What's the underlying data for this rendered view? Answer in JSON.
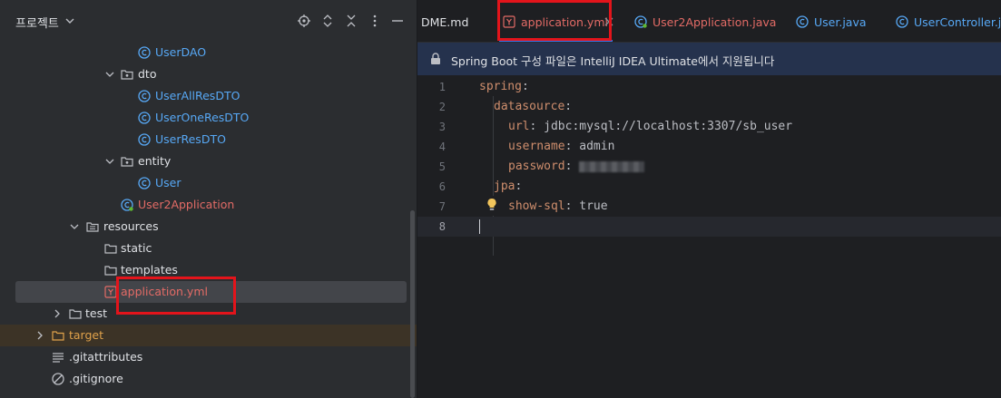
{
  "project_panel": {
    "title": "프로젝트",
    "tree": [
      {
        "label": "UserDAO",
        "icon": "class-icon",
        "kind": "class"
      },
      {
        "label": "dto",
        "icon": "package-icon",
        "kind": "folder"
      },
      {
        "label": "UserAllResDTO",
        "icon": "class-icon",
        "kind": "class"
      },
      {
        "label": "UserOneResDTO",
        "icon": "class-icon",
        "kind": "class"
      },
      {
        "label": "UserResDTO",
        "icon": "class-icon",
        "kind": "class"
      },
      {
        "label": "entity",
        "icon": "package-icon",
        "kind": "folder"
      },
      {
        "label": "User",
        "icon": "class-icon",
        "kind": "class"
      },
      {
        "label": "User2Application",
        "icon": "spring-class-icon",
        "kind": "app"
      },
      {
        "label": "resources",
        "icon": "resources-folder-icon",
        "kind": "folder"
      },
      {
        "label": "static",
        "icon": "folder-icon",
        "kind": "folder"
      },
      {
        "label": "templates",
        "icon": "folder-icon",
        "kind": "folder"
      },
      {
        "label": "application.yml",
        "icon": "yaml-file-icon",
        "kind": "yml"
      },
      {
        "label": "test",
        "icon": "folder-icon",
        "kind": "folder"
      },
      {
        "label": "target",
        "icon": "folder-icon",
        "kind": "target"
      },
      {
        "label": ".gitattributes",
        "icon": "text-file-icon",
        "kind": "file"
      },
      {
        "label": ".gitignore",
        "icon": "ignore-file-icon",
        "kind": "file"
      }
    ]
  },
  "editor": {
    "tabs": [
      {
        "label": "DME.md",
        "icon": "markdown-icon"
      },
      {
        "label": "application.yml",
        "icon": "yaml-file-icon",
        "active": true
      },
      {
        "label": "User2Application.java",
        "icon": "spring-class-icon"
      },
      {
        "label": "User.java",
        "icon": "class-icon"
      },
      {
        "label": "UserController.java",
        "icon": "class-icon"
      }
    ],
    "banner_text": "Spring Boot 구성 파일은 IntelliJ IDEA Ultimate에서 지원됩니다",
    "code_lines": [
      {
        "num": "1",
        "key": "spring",
        "value": ""
      },
      {
        "num": "2",
        "key": "datasource",
        "value": ""
      },
      {
        "num": "3",
        "key": "url",
        "value": "jdbc:mysql://localhost:3307/sb_user"
      },
      {
        "num": "4",
        "key": "username",
        "value": "admin"
      },
      {
        "num": "5",
        "key": "password",
        "value": ""
      },
      {
        "num": "6",
        "key": "jpa",
        "value": ""
      },
      {
        "num": "7",
        "key": "show-sql",
        "value": "true"
      },
      {
        "num": "8",
        "key": "",
        "value": ""
      }
    ]
  },
  "colors": {
    "accent": "#3574f0",
    "highlight_box": "#e3141b",
    "class_text": "#57a8f5",
    "yaml_key": "#cf8e6d"
  }
}
